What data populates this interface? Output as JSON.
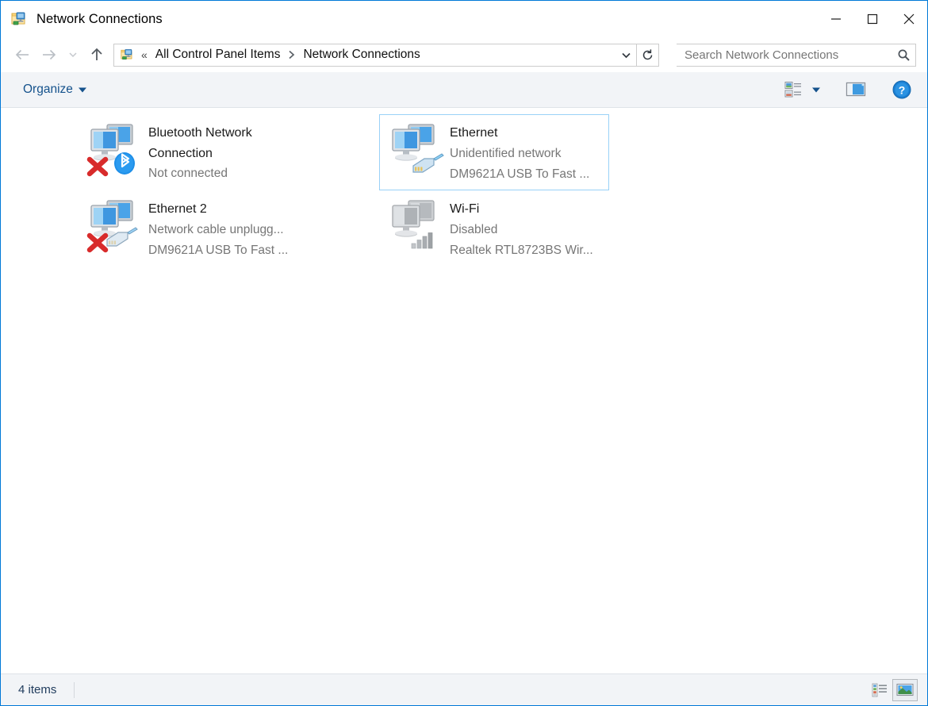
{
  "window": {
    "title": "Network Connections",
    "title_icon": "network-folder-icon",
    "minimize_label": "Minimize",
    "maximize_label": "Maximize",
    "close_label": "Close",
    "accent_color": "#0078d7"
  },
  "navigation": {
    "back_label": "Back",
    "forward_label": "Forward",
    "recent_label": "Recent locations",
    "up_label": "Up one level"
  },
  "address": {
    "prefix": "«",
    "crumbs": [
      "All Control Panel Items",
      "Network Connections"
    ],
    "dropdown_label": "Previous locations",
    "refresh_label": "Refresh"
  },
  "search": {
    "placeholder": "Search Network Connections",
    "value": ""
  },
  "toolbar": {
    "organize_label": "Organize",
    "view_options_label": "Change your view",
    "preview_pane_label": "Show the preview pane",
    "help_label": "Help"
  },
  "connections": [
    {
      "name": "Bluetooth Network Connection",
      "status": "Not connected",
      "device": "",
      "icon": "network-adapter-icon",
      "badge": "bluetooth-badge",
      "disconnected": true,
      "disabled": false,
      "selected": false
    },
    {
      "name": "Ethernet",
      "status": "Unidentified network",
      "device": "DM9621A USB To Fast ...",
      "icon": "network-adapter-icon",
      "badge": "rj45-badge",
      "disconnected": false,
      "disabled": false,
      "selected": true
    },
    {
      "name": "Ethernet 2",
      "status": "Network cable unplugg...",
      "device": "DM9621A USB To Fast ...",
      "icon": "network-adapter-icon",
      "badge": "rj45-badge",
      "disconnected": true,
      "disabled": false,
      "selected": false
    },
    {
      "name": "Wi-Fi",
      "status": "Disabled",
      "device": "Realtek RTL8723BS Wir...",
      "icon": "network-adapter-icon",
      "badge": "signal-bars-badge",
      "disconnected": false,
      "disabled": true,
      "selected": false
    }
  ],
  "statusbar": {
    "item_count": "4 items",
    "details_view_label": "Details view",
    "large_icons_view_label": "Large icons view",
    "active_view": "large-icons"
  }
}
